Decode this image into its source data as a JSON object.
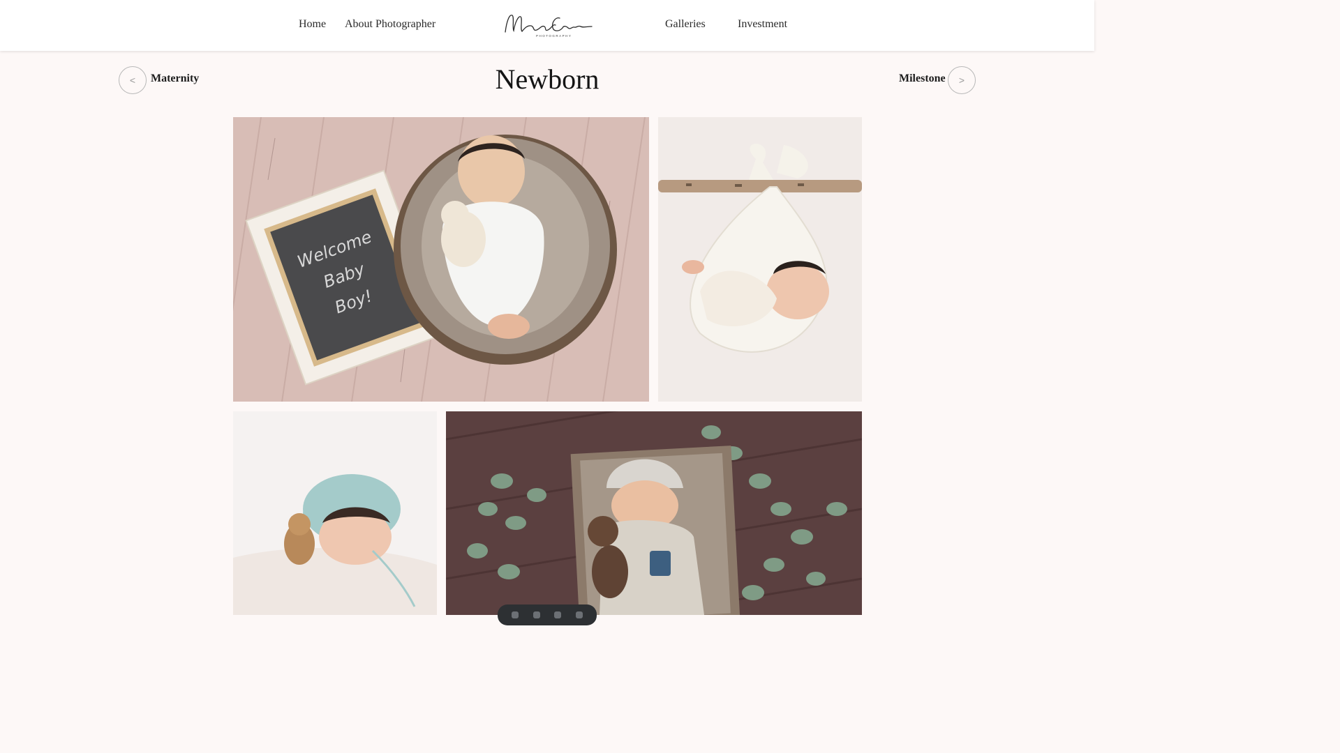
{
  "nav": {
    "home": "Home",
    "about": "About Photographer",
    "galleries": "Galleries",
    "investment": "Investment"
  },
  "logo": {
    "script_text": "Magnolia Coasts",
    "sub_text": "PHOTOGRAPHY"
  },
  "gallery_nav": {
    "prev_icon": "<",
    "prev_label": "Maternity",
    "title": "Newborn",
    "next_label": "Milestone",
    "next_icon": ">"
  },
  "photos": {
    "photo1_sign_line1": "Welcome",
    "photo1_sign_line2": "Baby",
    "photo1_sign_line3": "Boy!"
  },
  "colors": {
    "background": "#fdf8f7",
    "header": "#ffffff",
    "text": "#222222"
  }
}
